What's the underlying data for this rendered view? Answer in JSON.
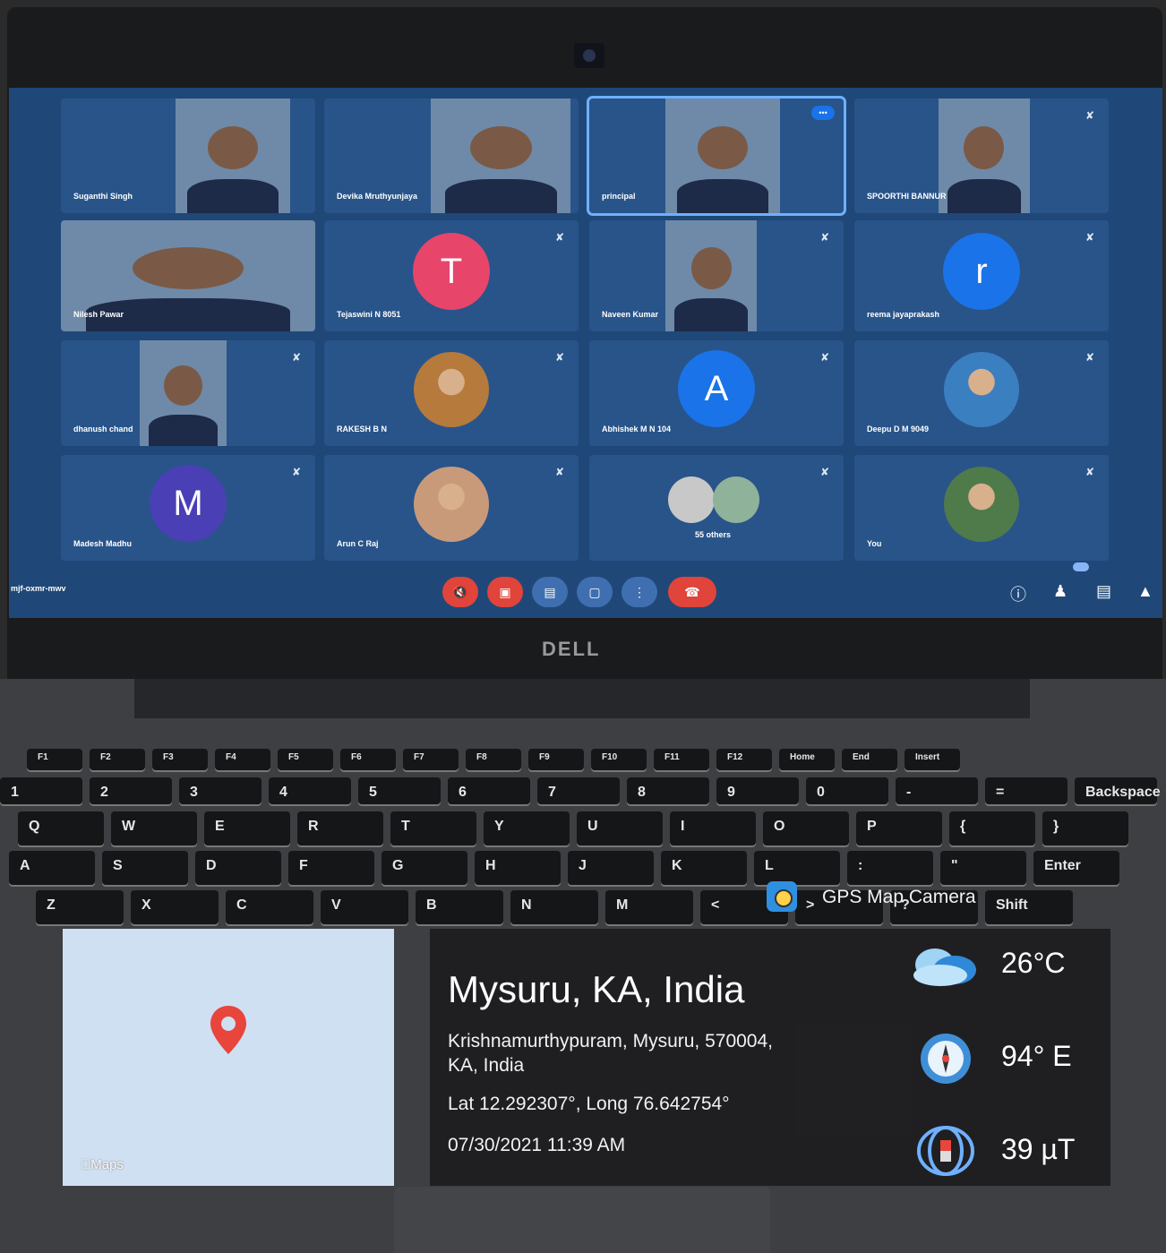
{
  "laptop": {
    "brand": "DELL"
  },
  "meet": {
    "meeting_code": "mjf-oxmr-mwv",
    "tiles": [
      {
        "name": "Suganthi Singh",
        "type": "video",
        "muted": false
      },
      {
        "name": "Devika Mruthyunjaya",
        "type": "video",
        "muted": false
      },
      {
        "name": "principal",
        "type": "video",
        "muted": false,
        "active": true
      },
      {
        "name": "SPOORTHI BANNUR",
        "type": "video",
        "muted": true
      },
      {
        "name": "Nilesh Pawar",
        "type": "video",
        "muted": false
      },
      {
        "name": "Tejaswini N 8051",
        "type": "letter",
        "letter": "T",
        "color": "#e8456a",
        "muted": true
      },
      {
        "name": "Naveen Kumar",
        "type": "video",
        "muted": true
      },
      {
        "name": "reema jayaprakash",
        "type": "letter",
        "letter": "r",
        "color": "#1a73e8",
        "muted": true
      },
      {
        "name": "dhanush chand",
        "type": "video",
        "muted": true
      },
      {
        "name": "RAKESH B N",
        "type": "photo",
        "muted": true
      },
      {
        "name": "Abhishek M N 104",
        "type": "letter",
        "letter": "A",
        "color": "#1a73e8",
        "muted": true
      },
      {
        "name": "Deepu D M 9049",
        "type": "photo",
        "muted": true
      },
      {
        "name": "Madesh Madhu",
        "type": "letter",
        "letter": "M",
        "color": "#4a3fb5",
        "muted": true
      },
      {
        "name": "Arun C Raj",
        "type": "photo",
        "muted": true
      },
      {
        "name": "55 others",
        "type": "others",
        "muted": true
      },
      {
        "name": "You",
        "type": "photo",
        "muted": true
      }
    ],
    "controls": {
      "mic": "mic-off",
      "camera": "camera-off",
      "captions": "captions",
      "present": "present",
      "more": "more",
      "hangup": "hang-up"
    }
  },
  "keyboard": {
    "rows": [
      [
        "F1",
        "F2",
        "F3",
        "F4",
        "F5",
        "F6",
        "F7",
        "F8",
        "F9",
        "F10",
        "F11",
        "F12",
        "Home",
        "End",
        "Insert"
      ],
      [
        "1",
        "2",
        "3",
        "4",
        "5",
        "6",
        "7",
        "8",
        "9",
        "0",
        "-",
        "=",
        "Backspace"
      ],
      [
        "Q",
        "W",
        "E",
        "R",
        "T",
        "Y",
        "U",
        "I",
        "O",
        "P",
        "{",
        "}"
      ],
      [
        "A",
        "S",
        "D",
        "F",
        "G",
        "H",
        "J",
        "K",
        "L",
        ":",
        "\"",
        "Enter"
      ],
      [
        "Z",
        "X",
        "C",
        "V",
        "B",
        "N",
        "M",
        "<",
        ">",
        "?",
        "Shift"
      ]
    ]
  },
  "gps": {
    "app_name": "GPS Map Camera",
    "maps_label": "Maps",
    "city": "Mysuru, KA, India",
    "address": "Krishnamurthypuram, Mysuru, 570004, KA, India",
    "lat_long": "Lat 12.292307°, Long 76.642754°",
    "datetime": "07/30/2021 11:39 AM",
    "temperature": "26°C",
    "direction": "94° E",
    "magnetic": "39 µT"
  }
}
